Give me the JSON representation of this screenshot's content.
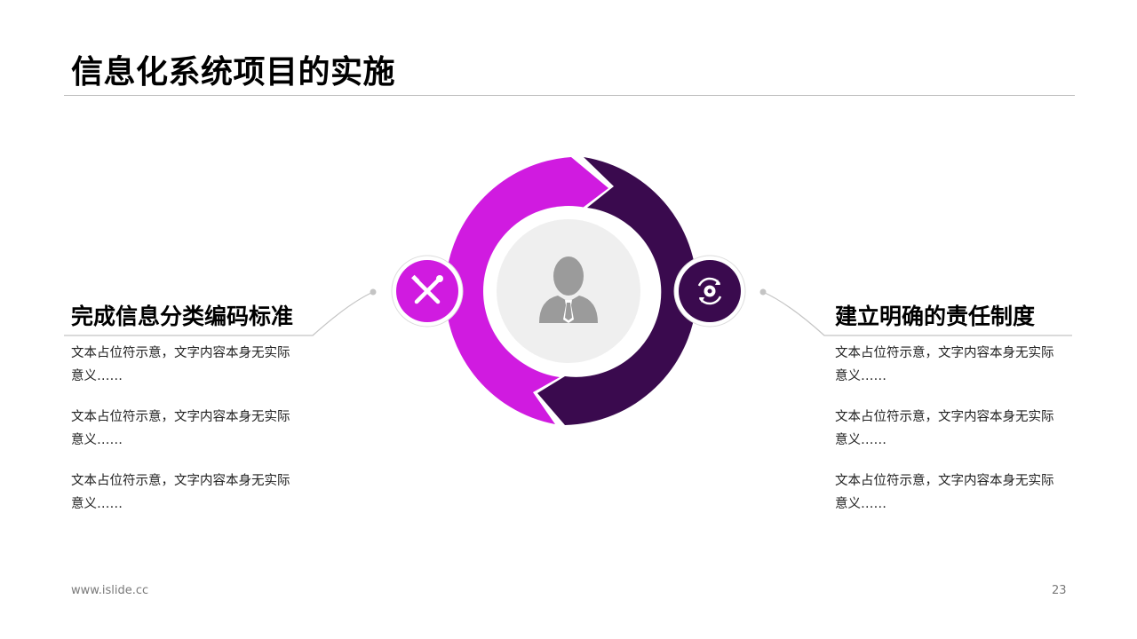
{
  "title": "信息化系统项目的实施",
  "left": {
    "heading": "完成信息分类编码标准",
    "items": [
      "文本占位符示意，文字内容本身无实际意义……",
      "文本占位符示意，文字内容本身无实际意义……",
      "文本占位符示意，文字内容本身无实际意义……"
    ],
    "icon": "tools-icon"
  },
  "right": {
    "heading": "建立明确的责任制度",
    "items": [
      "文本占位符示意，文字内容本身无实际意义……",
      "文本占位符示意，文字内容本身无实际意义……",
      "文本占位符示意，文字内容本身无实际意义……"
    ],
    "icon": "gear-cycle-icon"
  },
  "center": {
    "icon": "person-icon"
  },
  "colors": {
    "magenta": "#D01BE0",
    "dark_purple": "#3A0A4E",
    "center_gray": "#EFEFEF",
    "person_gray": "#9B9B9B",
    "rule_gray": "#BDBDBD"
  },
  "footer": {
    "url": "www.islide.cc",
    "page": "23"
  }
}
